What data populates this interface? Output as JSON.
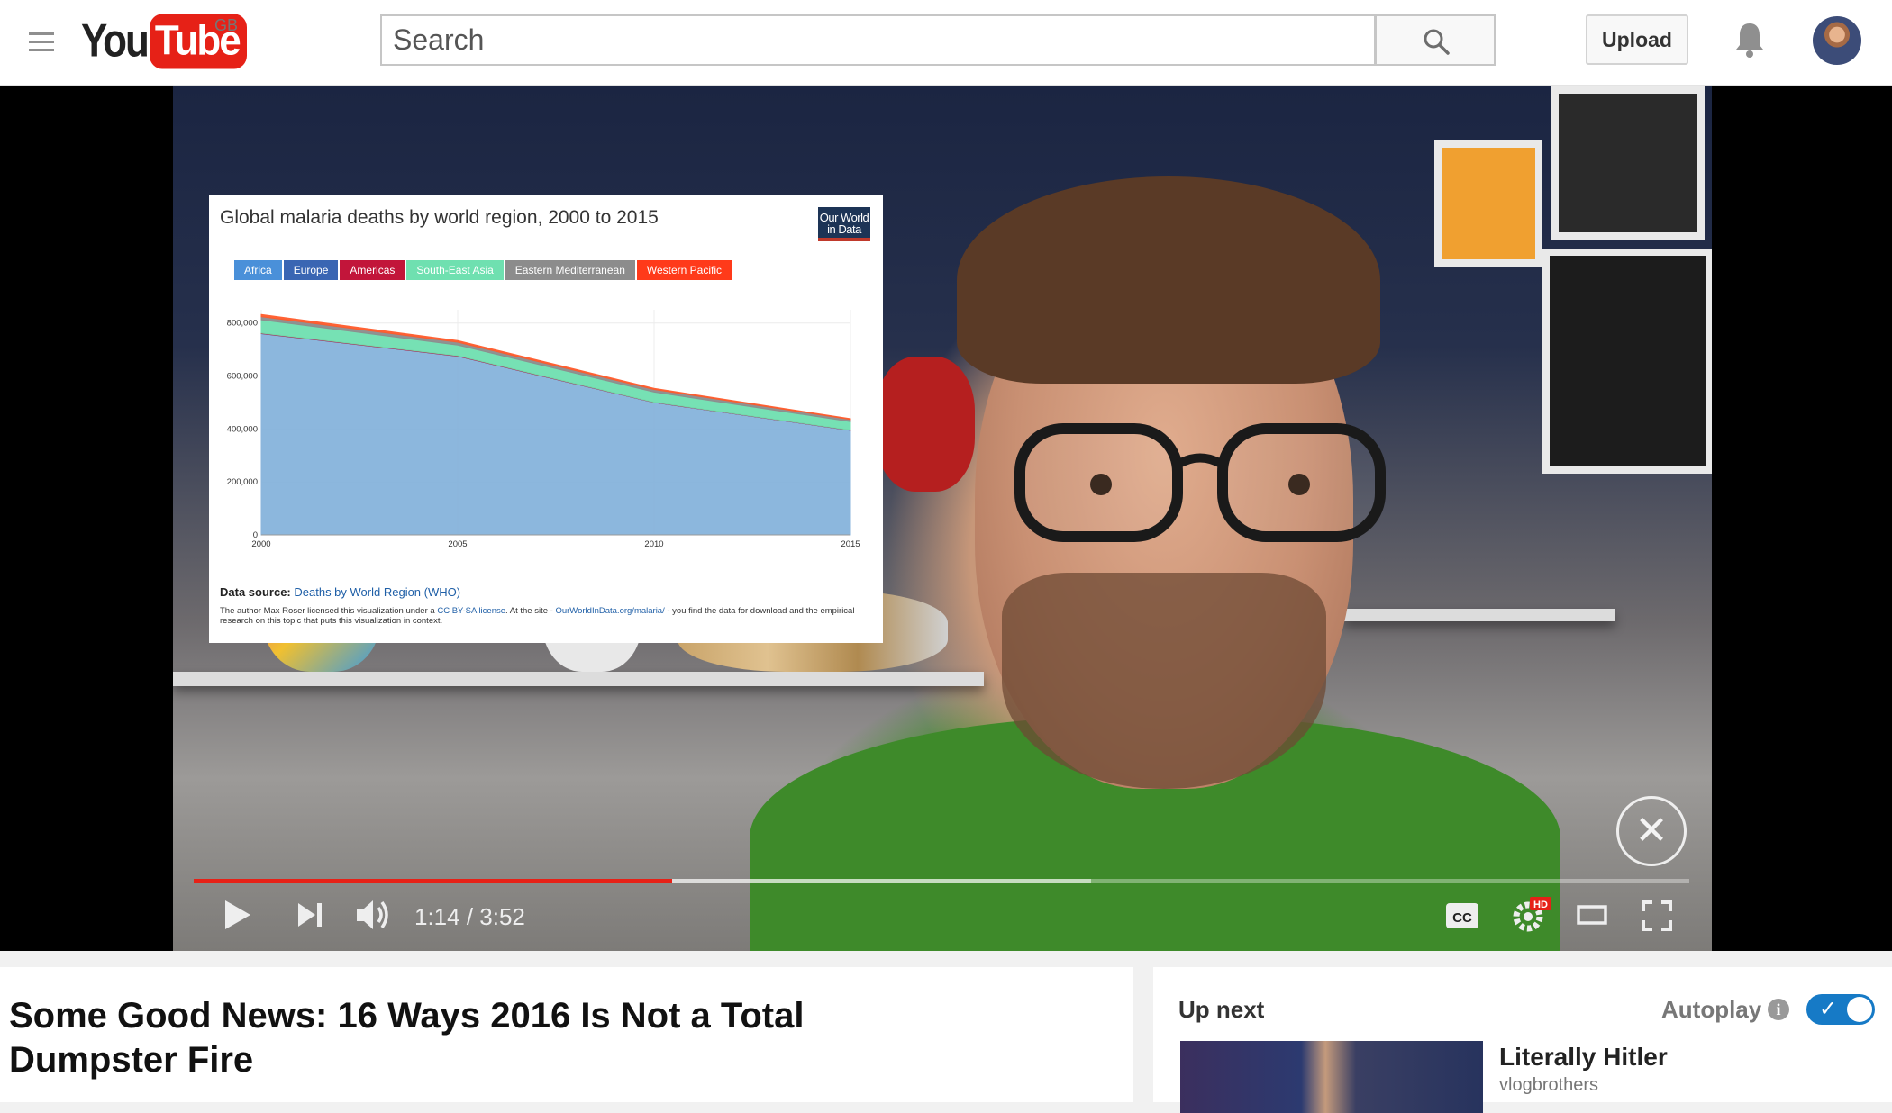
{
  "masthead": {
    "logo_you": "You",
    "logo_tube": "Tube",
    "region": "GB",
    "search_placeholder": "Search",
    "upload_label": "Upload",
    "icons": [
      "menu-icon",
      "search-icon",
      "bell-icon"
    ]
  },
  "player": {
    "current_time": "1:14",
    "duration": "3:52",
    "time_display": "1:14 / 3:52",
    "played_fraction": 0.32,
    "loaded_fraction": 0.6,
    "hd_badge": "HD",
    "cc_label": "CC",
    "colors": {
      "progress_played": "#e62117"
    }
  },
  "chart_overlay": {
    "brand": "Our World in Data",
    "source_label": "Data source:",
    "source_link": "Deaths by World Region (WHO)",
    "license_prefix": "The author Max Roser licensed this visualization under a",
    "license_link": "CC BY-SA license",
    "license_mid": ". At the site -",
    "site_link": "OurWorldInData.org/malaria/",
    "license_suffix": "- you find the data for download and the empirical research on this topic that puts this visualization in context."
  },
  "chart_data": {
    "type": "area",
    "title": "Global malaria deaths by world region, 2000 to 2015",
    "x": [
      2000,
      2005,
      2010,
      2015
    ],
    "xticks": [
      "2000",
      "2005",
      "2010",
      "2015"
    ],
    "yticks": [
      "0",
      "200,000",
      "400,000",
      "600,000",
      "800,000"
    ],
    "ylim": [
      0,
      850000
    ],
    "stacked": true,
    "grid": true,
    "legend_position": "top-left",
    "series": [
      {
        "name": "Africa",
        "color": "#86b4dc",
        "values": [
          760000,
          675000,
          500000,
          395000
        ]
      },
      {
        "name": "Europe",
        "color": "#3a66b3",
        "values": [
          0,
          0,
          0,
          0
        ]
      },
      {
        "name": "Americas",
        "color": "#c2153a",
        "values": [
          2000,
          1500,
          1200,
          800
        ]
      },
      {
        "name": "South-East Asia",
        "color": "#6fe0b0",
        "values": [
          50000,
          40000,
          38000,
          32000
        ]
      },
      {
        "name": "Eastern Mediterranean",
        "color": "#8c8c8c",
        "values": [
          12000,
          11000,
          10000,
          8000
        ]
      },
      {
        "name": "Western Pacific",
        "color": "#ff5a2a",
        "values": [
          8000,
          6000,
          4000,
          3000
        ]
      }
    ],
    "legend_colors": [
      "#4a90d9",
      "#3a66b3",
      "#c2153a",
      "#6fe0b0",
      "#8c8c8c",
      "#ff3a1a"
    ]
  },
  "below": {
    "video_title": "Some Good News: 16 Ways 2016 Is Not a Total Dumpster Fire",
    "up_next_label": "Up next",
    "autoplay_label": "Autoplay",
    "autoplay_on": true,
    "next_video_title": "Literally Hitler",
    "next_video_channel": "vlogbrothers"
  }
}
